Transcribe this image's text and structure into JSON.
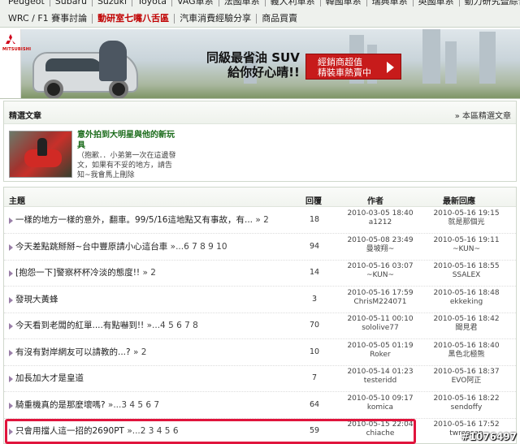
{
  "nav": {
    "row1": [
      "Peugeot",
      "Subaru",
      "Suzuki",
      "Toyota",
      "VAG車系",
      "法國車系",
      "義大利車系",
      "韓國車系",
      "瑞典車系",
      "英國車系",
      "動力研究暨綜合區"
    ],
    "row2": [
      "WRC / F1 賽事討論",
      "動研室七嘴八舌區",
      "汽車消費經驗分享",
      "商品買賣"
    ],
    "highlighted": "動研室七嘴八舌區"
  },
  "banner": {
    "logo_text": "MITSUBISHI",
    "slogan_line1": "同級最省油 SUV",
    "slogan_line2": "給你好心晴!!",
    "cta_line1": "經銷商超值",
    "cta_line2": "精裝車熱賣中"
  },
  "featured": {
    "title": "精選文章",
    "more_link": "» 本區精選文章",
    "headline": "意外拍到大明星與他的新玩具",
    "summary": "（抱歉．．小弟第一次在這邊發文，如果有不妥的地方，請告知~我會馬上刪除"
  },
  "threads": {
    "headers": {
      "topic": "主題",
      "replies": "回覆",
      "author": "作者",
      "last_reply": "最新回應"
    },
    "rows": [
      {
        "title": "一樣的地方一樣的意外，翻車。99/5/16這地點又有事故，有...",
        "pages": "» 2",
        "replies": "18",
        "date": "2010-03-05 18:40",
        "author": "a1212",
        "last_date": "2010-05-16 19:15",
        "last_by": "就是那個光"
      },
      {
        "title": "今天差點跳掰掰~台中豐原請小心這台車",
        "pages": "»...6 7 8 9 10",
        "replies": "94",
        "date": "2010-05-08 23:49",
        "author": "曼坡翔~",
        "last_date": "2010-05-16 19:11",
        "last_by": "~KUN~"
      },
      {
        "title": "[抱怨一下]警察杯杯冷淡的態度!!",
        "pages": "» 2",
        "replies": "14",
        "date": "2010-05-16 03:07",
        "author": "~KUN~",
        "last_date": "2010-05-16 18:55",
        "last_by": "SSALEX"
      },
      {
        "title": "發現大黃蜂",
        "pages": "",
        "replies": "3",
        "date": "2010-05-16 17:59",
        "author": "ChrisM224071",
        "last_date": "2010-05-16 18:48",
        "last_by": "ekkeking"
      },
      {
        "title": "今天看到老闆的紅單....有點嚇到!!",
        "pages": "»...4 5 6 7 8",
        "replies": "70",
        "date": "2010-05-11 00:10",
        "author": "sololive77",
        "last_date": "2010-05-16 18:42",
        "last_by": "聞見君"
      },
      {
        "title": "有沒有對岸網友可以請教的...?",
        "pages": "» 2",
        "replies": "10",
        "date": "2010-05-05 01:19",
        "author": "Roker",
        "last_date": "2010-05-16 18:40",
        "last_by": "黑色北極熊"
      },
      {
        "title": "加長加大才是皇道",
        "pages": "",
        "replies": "7",
        "date": "2010-05-14 01:23",
        "author": "testeridd",
        "last_date": "2010-05-16 18:37",
        "last_by": "EVO阿正"
      },
      {
        "title": "騎重機真的是那麼壞嗎?",
        "pages": "»...3 4 5 6 7",
        "replies": "64",
        "date": "2010-05-10 09:17",
        "author": "komica",
        "last_date": "2010-05-16 18:22",
        "last_by": "sendoffy"
      },
      {
        "title": "只會用擋人這一招的2690PT",
        "pages": "»...2 3 4 5 6",
        "replies": "59",
        "date": "2010-05-15 22:04",
        "author": "chiache",
        "last_date": "2010-05-16 17:52",
        "last_by": "twrensan"
      }
    ]
  },
  "watermark": "#1076497",
  "colors": {
    "nav_bg": "#eef1ed",
    "highlight_nav": "#c00000",
    "cta_red": "#c71b1b",
    "headline_green": "#1a6b1a",
    "marker_border": "#e0143c"
  }
}
